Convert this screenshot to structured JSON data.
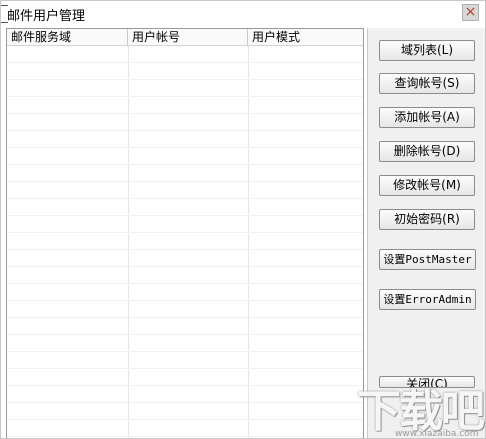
{
  "window": {
    "title": "邮件用户管理",
    "close_label": "×"
  },
  "list": {
    "columns": [
      "邮件服务域",
      "用户帐号",
      "用户模式"
    ]
  },
  "buttons": {
    "domain_list": "域列表(L)",
    "query_account": "查询帐号(S)",
    "add_account": "添加帐号(A)",
    "delete_account": "删除帐号(D)",
    "modify_account": "修改帐号(M)",
    "init_password": "初始密码(R)",
    "set_postmaster": "设置PostMaster",
    "set_erroradmin": "设置ErrorAdmin",
    "close": "关闭(C)"
  },
  "watermark": {
    "text": "下载吧",
    "url": "www.xiazaiba.com"
  }
}
